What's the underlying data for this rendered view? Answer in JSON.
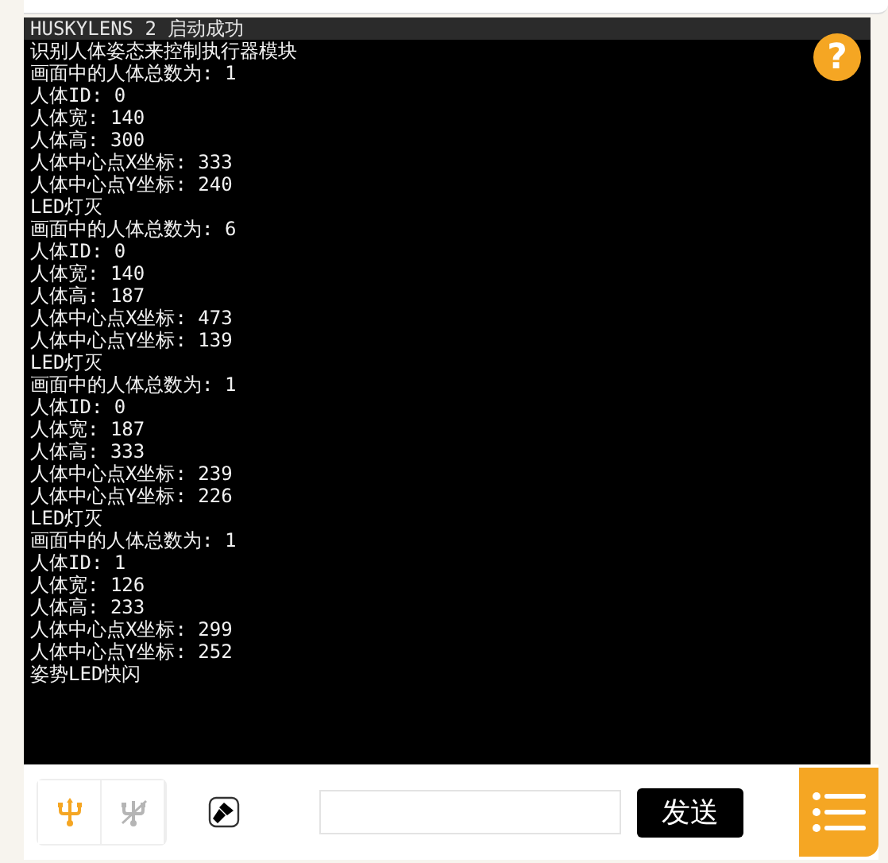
{
  "console": {
    "header": "HUSKYLENS 2 启动成功",
    "lines": [
      "识别人体姿态来控制执行器模块",
      "画面中的人体总数为: 1",
      "人体ID: 0",
      "人体宽: 140",
      "人体高: 300",
      "人体中心点X坐标: 333",
      "人体中心点Y坐标: 240",
      "LED灯灭",
      "画面中的人体总数为: 6",
      "人体ID: 0",
      "人体宽: 140",
      "人体高: 187",
      "人体中心点X坐标: 473",
      "人体中心点Y坐标: 139",
      "LED灯灭",
      "画面中的人体总数为: 1",
      "人体ID: 0",
      "人体宽: 187",
      "人体高: 333",
      "人体中心点X坐标: 239",
      "人体中心点Y坐标: 226",
      "LED灯灭",
      "画面中的人体总数为: 1",
      "人体ID: 1",
      "人体宽: 126",
      "人体高: 233",
      "人体中心点X坐标: 299",
      "人体中心点Y坐标: 252",
      "姿势LED快闪"
    ],
    "help": "?"
  },
  "toolbar": {
    "usb_buttons": [
      {
        "kind": "connect"
      },
      {
        "kind": "disconnect"
      }
    ],
    "send_button": "发送"
  }
}
